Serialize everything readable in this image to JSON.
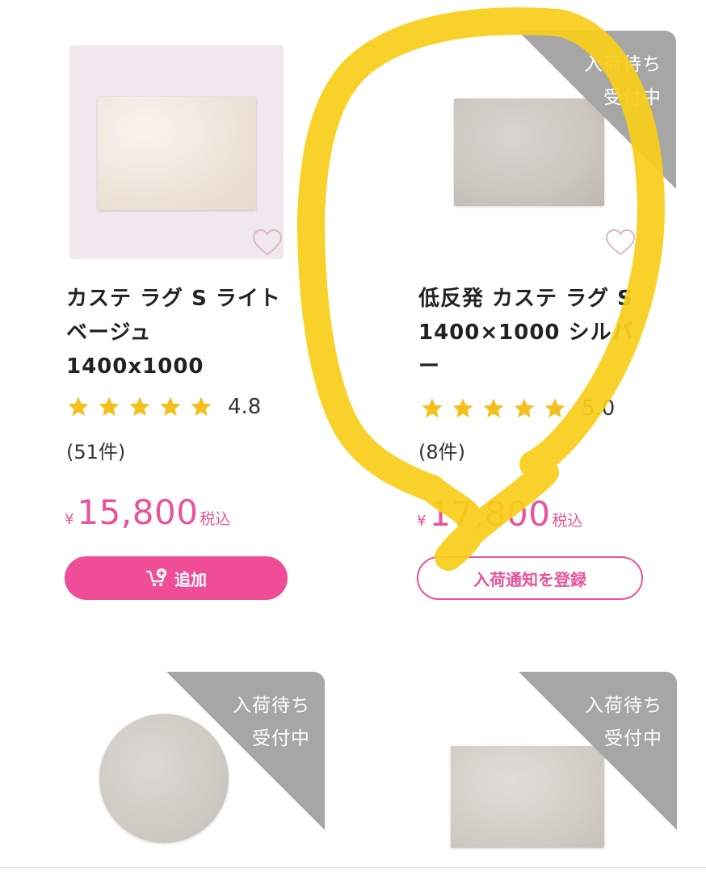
{
  "colors": {
    "accent_pink": "#ef4d98",
    "price_pink": "#e8539a",
    "star_yellow": "#f5c01d",
    "ribbon_gray": "#a6a6a6",
    "highlight_yellow": "#f7cf1a"
  },
  "products": [
    {
      "title": "カステ ラグ S ライトベージュ 1400x1000",
      "rating": "4.8",
      "stars": 5,
      "review_count": "(51件)",
      "price_yen": "¥",
      "price": "15,800",
      "tax_label": "税込",
      "button_label": "追加",
      "button_icon": "cart-plus-icon"
    },
    {
      "title": "低反発 カステ ラグ S 1400×1000 シルバー",
      "rating": "5.0",
      "stars": 5,
      "review_count": "(8件)",
      "price_yen": "¥",
      "price": "17,800",
      "tax_label": "税込",
      "button_label": "入荷通知を登録",
      "ribbon_line1": "入荷待ち",
      "ribbon_line2": "受付中"
    },
    {
      "ribbon_line1": "入荷待ち",
      "ribbon_line2": "受付中"
    },
    {
      "ribbon_line1": "入荷待ち",
      "ribbon_line2": "受付中"
    }
  ]
}
